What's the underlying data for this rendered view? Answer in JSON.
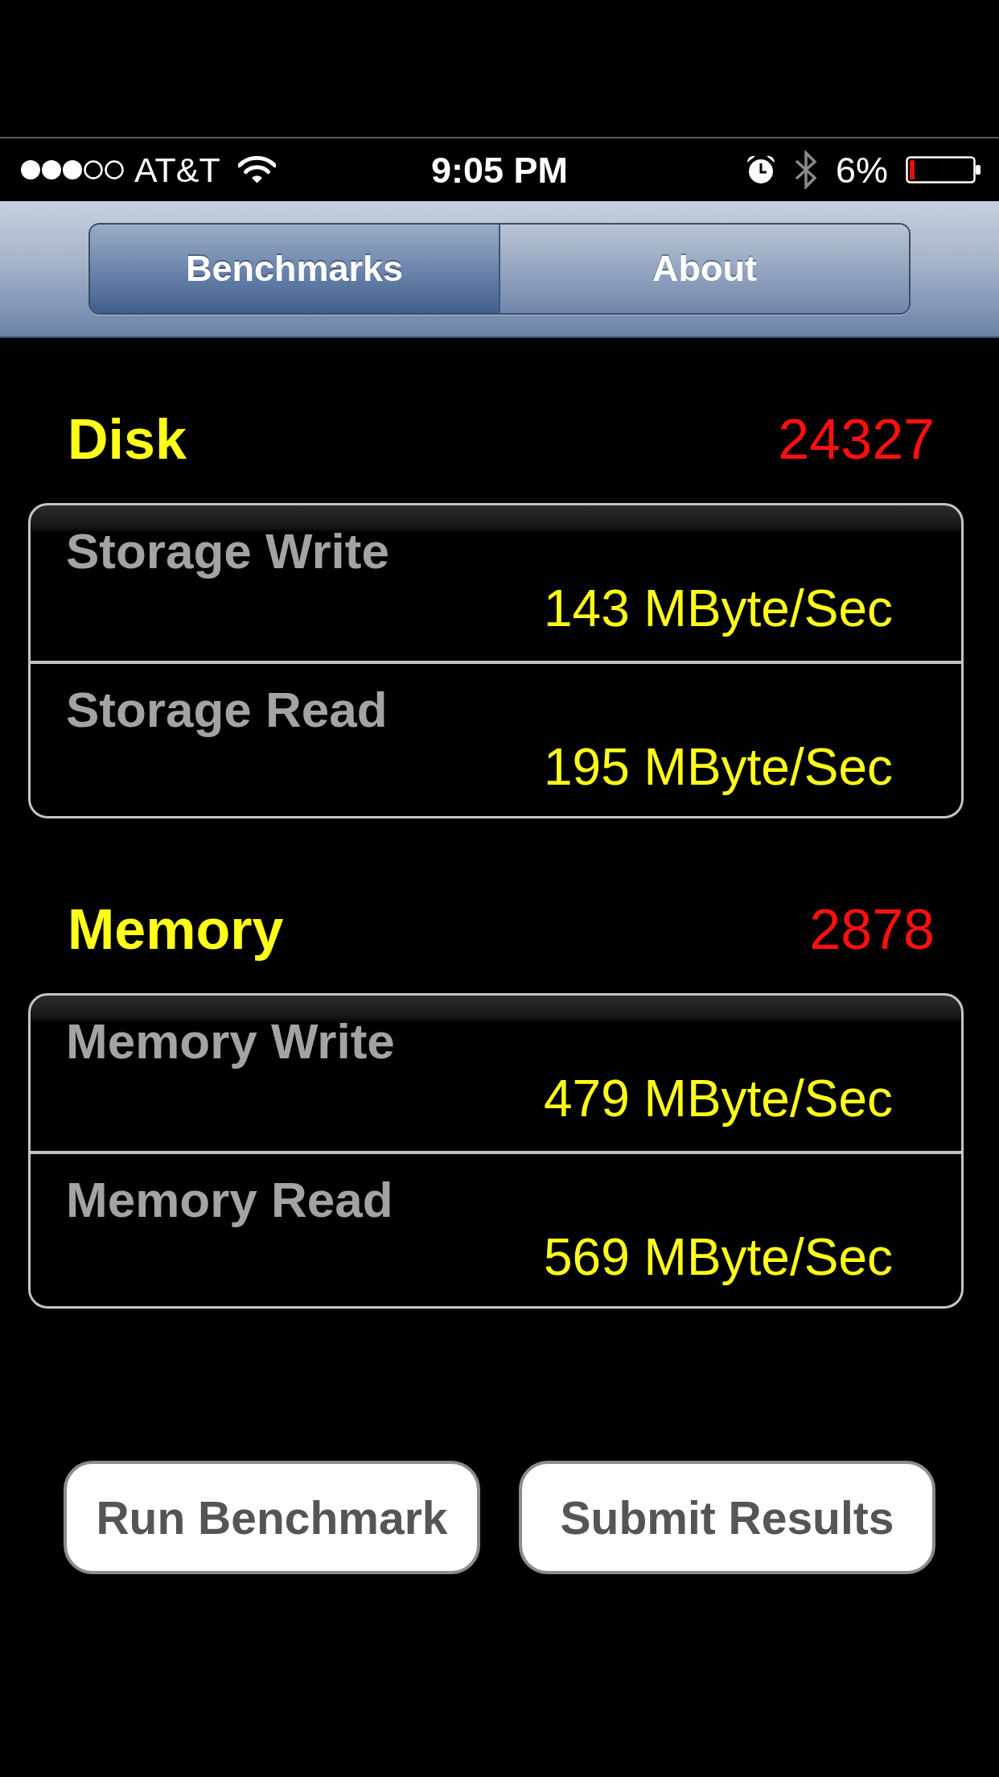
{
  "status_bar": {
    "carrier": "AT&T",
    "time": "9:05 PM",
    "battery": "6%"
  },
  "tabs": [
    {
      "label": "Benchmarks",
      "selected": true
    },
    {
      "label": "About",
      "selected": false
    }
  ],
  "sections": [
    {
      "title": "Disk",
      "score": "24327",
      "rows": [
        {
          "label": "Storage Write",
          "value": "143 MByte/Sec"
        },
        {
          "label": "Storage Read",
          "value": "195 MByte/Sec"
        }
      ]
    },
    {
      "title": "Memory",
      "score": "2878",
      "rows": [
        {
          "label": "Memory Write",
          "value": "479 MByte/Sec"
        },
        {
          "label": "Memory Read",
          "value": "569 MByte/Sec"
        }
      ]
    }
  ],
  "buttons": [
    "Run Benchmark",
    "Submit Results"
  ]
}
